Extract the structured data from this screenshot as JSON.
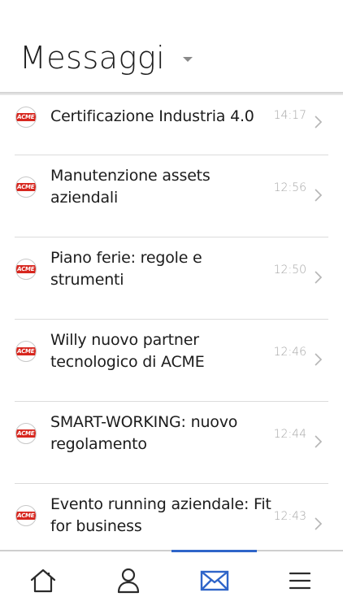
{
  "header": {
    "title": "Messaggi",
    "dropdown_icon": "caret-down-icon"
  },
  "messages": [
    {
      "subject": "Certificazione Industria 4.0",
      "time": "14:17",
      "sender_logo": "ACME"
    },
    {
      "subject": "Manutenzione assets aziendali",
      "time": "12:56",
      "sender_logo": "ACME"
    },
    {
      "subject": "Piano ferie: regole e strumenti",
      "time": "12:50",
      "sender_logo": "ACME"
    },
    {
      "subject": "Willy nuovo partner tecnologico di ACME",
      "time": "12:46",
      "sender_logo": "ACME"
    },
    {
      "subject": "SMART-WORKING: nuovo regolamento",
      "time": "12:44",
      "sender_logo": "ACME"
    },
    {
      "subject": "Evento running aziendale: Fit for business",
      "time": "12:43",
      "sender_logo": "ACME"
    }
  ],
  "bottom_nav": {
    "items": [
      {
        "icon": "home-icon",
        "active": false
      },
      {
        "icon": "user-icon",
        "active": false
      },
      {
        "icon": "envelope-icon",
        "active": true
      },
      {
        "icon": "menu-icon",
        "active": false
      }
    ]
  },
  "colors": {
    "accent": "#2f65c9",
    "logo_red": "#d7261e",
    "text": "#1c1c1c",
    "time": "#a6a6a6",
    "divider": "#dcdcdc"
  }
}
